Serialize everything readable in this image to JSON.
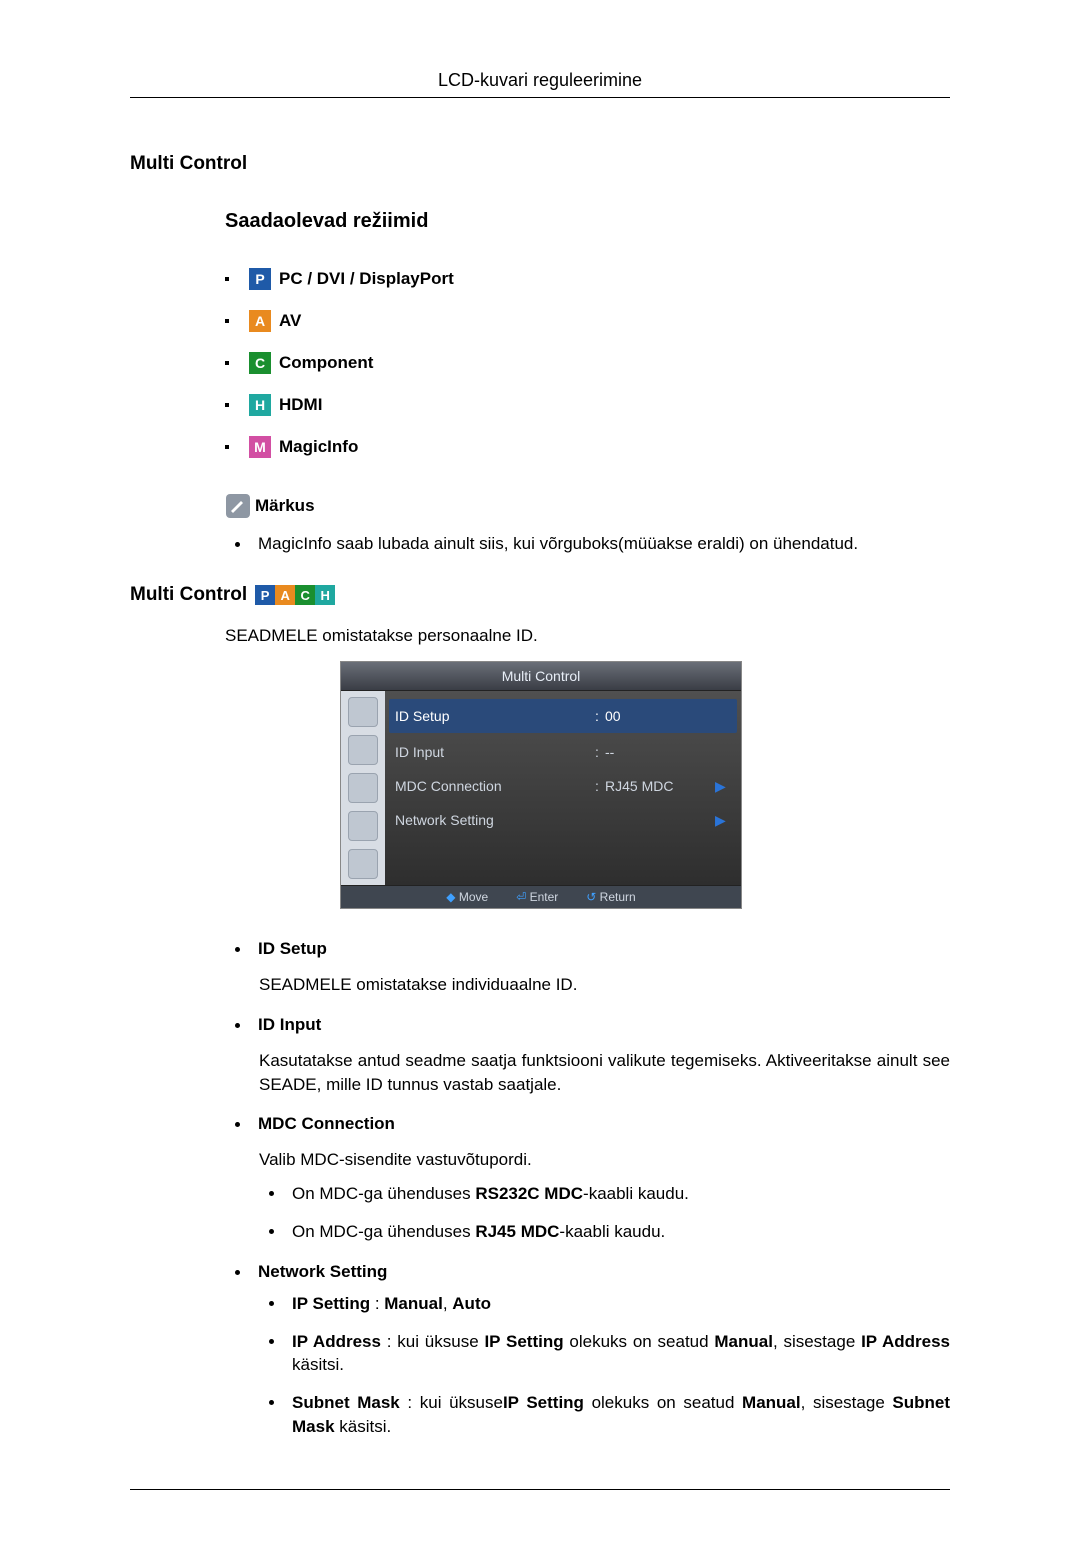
{
  "header": {
    "title": "LCD-kuvari reguleerimine"
  },
  "section1": {
    "title": "Multi Control",
    "subtitle": "Saadaolevad režiimid",
    "modes": [
      {
        "icon": "P",
        "label": "PC / DVI / DisplayPort",
        "bg": "bg-blue"
      },
      {
        "icon": "A",
        "label": "AV",
        "bg": "bg-orange"
      },
      {
        "icon": "C",
        "label": "Component",
        "bg": "bg-green"
      },
      {
        "icon": "H",
        "label": "HDMI",
        "bg": "bg-teal"
      },
      {
        "icon": "M",
        "label": "MagicInfo",
        "bg": "bg-pink"
      }
    ],
    "note_label": "Märkus",
    "note_text": "MagicInfo saab lubada ainult siis, kui võrguboks(müüakse eraldi) on ühendatud."
  },
  "section2": {
    "title": "Multi Control",
    "intro": "SEADMELE omistatakse personaalne ID.",
    "osd": {
      "title": "Multi Control",
      "rows": [
        {
          "label": "ID Setup",
          "colon": ":",
          "value": "00",
          "arrow": "",
          "hl": true
        },
        {
          "label": "ID Input",
          "colon": ":",
          "value": "--",
          "arrow": "",
          "hl": false
        },
        {
          "label": "MDC Connection",
          "colon": ":",
          "value": "RJ45 MDC",
          "arrow": "▶",
          "hl": false
        },
        {
          "label": "Network Setting",
          "colon": "",
          "value": "",
          "arrow": "▶",
          "hl": false
        }
      ],
      "footer": {
        "move": "Move",
        "enter": "Enter",
        "ret": "Return"
      }
    },
    "defs": {
      "id_setup": {
        "title": "ID Setup",
        "body": "SEADMELE omistatakse individuaalne ID."
      },
      "id_input": {
        "title": "ID Input",
        "body": "Kasutatakse antud seadme saatja funktsiooni valikute tegemiseks. Aktiveeritakse ainult see SEADE, mille ID tunnus vastab saatjale."
      },
      "mdc": {
        "title": "MDC Connection",
        "body": "Valib MDC-sisendite vastuvõtupordi.",
        "sub1_a": "On MDC-ga ühenduses ",
        "sub1_b": "RS232C MDC",
        "sub1_c": "-kaabli kaudu.",
        "sub2_a": "On MDC-ga ühenduses ",
        "sub2_b": "RJ45 MDC",
        "sub2_c": "-kaabli kaudu."
      },
      "net": {
        "title": "Network Setting",
        "ip_setting_k": "IP Setting",
        "ip_setting_sep": " : ",
        "ip_setting_v1": "Manual",
        "ip_setting_comma": ", ",
        "ip_setting_v2": "Auto",
        "ip_addr_k": "IP Address",
        "ip_addr_mid1": " : kui üksuse ",
        "ip_addr_ref": "IP Setting",
        "ip_addr_mid2": " olekuks on seatud ",
        "ip_addr_val": "Manual",
        "ip_addr_mid3": ", sisestage ",
        "ip_addr_obj": "IP Address",
        "ip_addr_end": " käsitsi.",
        "sm_k": "Subnet Mask",
        "sm_mid1": " : kui üksuse",
        "sm_ref": "IP Setting",
        "sm_mid2": " olekuks on seatud ",
        "sm_val": "Manual",
        "sm_mid3": ", sisestage ",
        "sm_obj": "Subnet Mask",
        "sm_end": " käsitsi."
      }
    }
  }
}
